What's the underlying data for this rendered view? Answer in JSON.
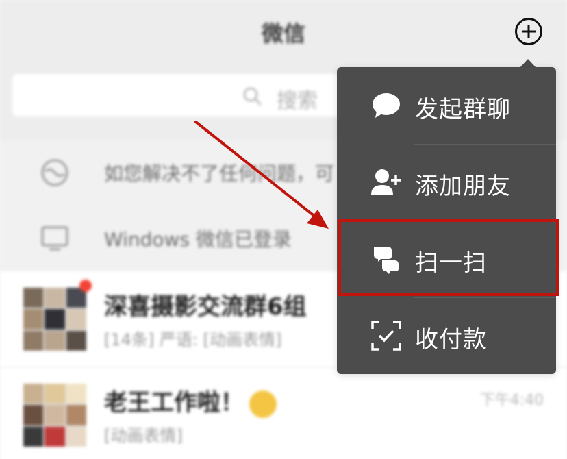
{
  "header": {
    "title": "微信",
    "add_icon": "plus-circle-icon"
  },
  "search": {
    "placeholder": "搜索",
    "icon": "search-icon"
  },
  "notices": [
    {
      "icon": "globe-icon",
      "text": "如您解决不了任何问题，可"
    },
    {
      "icon": "monitor-icon",
      "text": "Windows 微信已登录"
    }
  ],
  "chats": [
    {
      "name": "深喜摄影交流群6组",
      "preview": "[14条] 严语: [动画表情]",
      "time": "",
      "unread_dot": true
    },
    {
      "name": "老王工作啦！",
      "preview": "[动画表情]",
      "time": "下午4:40",
      "unread_dot": false
    }
  ],
  "menu": {
    "items": [
      {
        "icon": "chat-bubble-icon",
        "label": "发起群聊"
      },
      {
        "icon": "add-friend-icon",
        "label": "添加朋友"
      },
      {
        "icon": "scan-icon",
        "label": "扫一扫"
      },
      {
        "icon": "payment-icon",
        "label": "收付款"
      }
    ],
    "highlighted": "扫一扫"
  },
  "colors": {
    "menu_bg": "#4c4c4c",
    "highlight": "#c0140c",
    "arrow": "#c0140c",
    "header_bg": "#ededed"
  }
}
